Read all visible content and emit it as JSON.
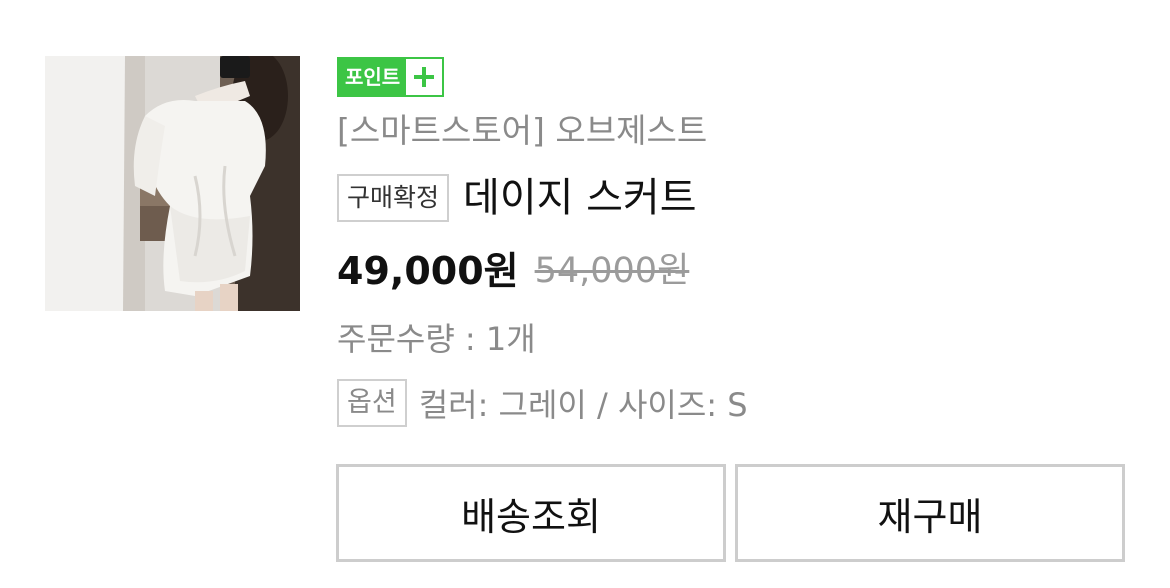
{
  "order_item": {
    "point_badge": {
      "label": "포인트",
      "icon": "plus-icon",
      "color": "#3cc545"
    },
    "store": "[스마트스토어] 오브제스트",
    "status_tag": "구매확정",
    "product_name": "데이지 스커트",
    "price": "49,000원",
    "original_price": "54,000원",
    "quantity": "주문수량 : 1개",
    "option_tag": "옵션",
    "option_text": "컬러: 그레이 / 사이즈: S",
    "thumbnail": "product-photo-white-dress"
  },
  "actions": {
    "track_label": "배송조회",
    "rebuy_label": "재구매"
  }
}
